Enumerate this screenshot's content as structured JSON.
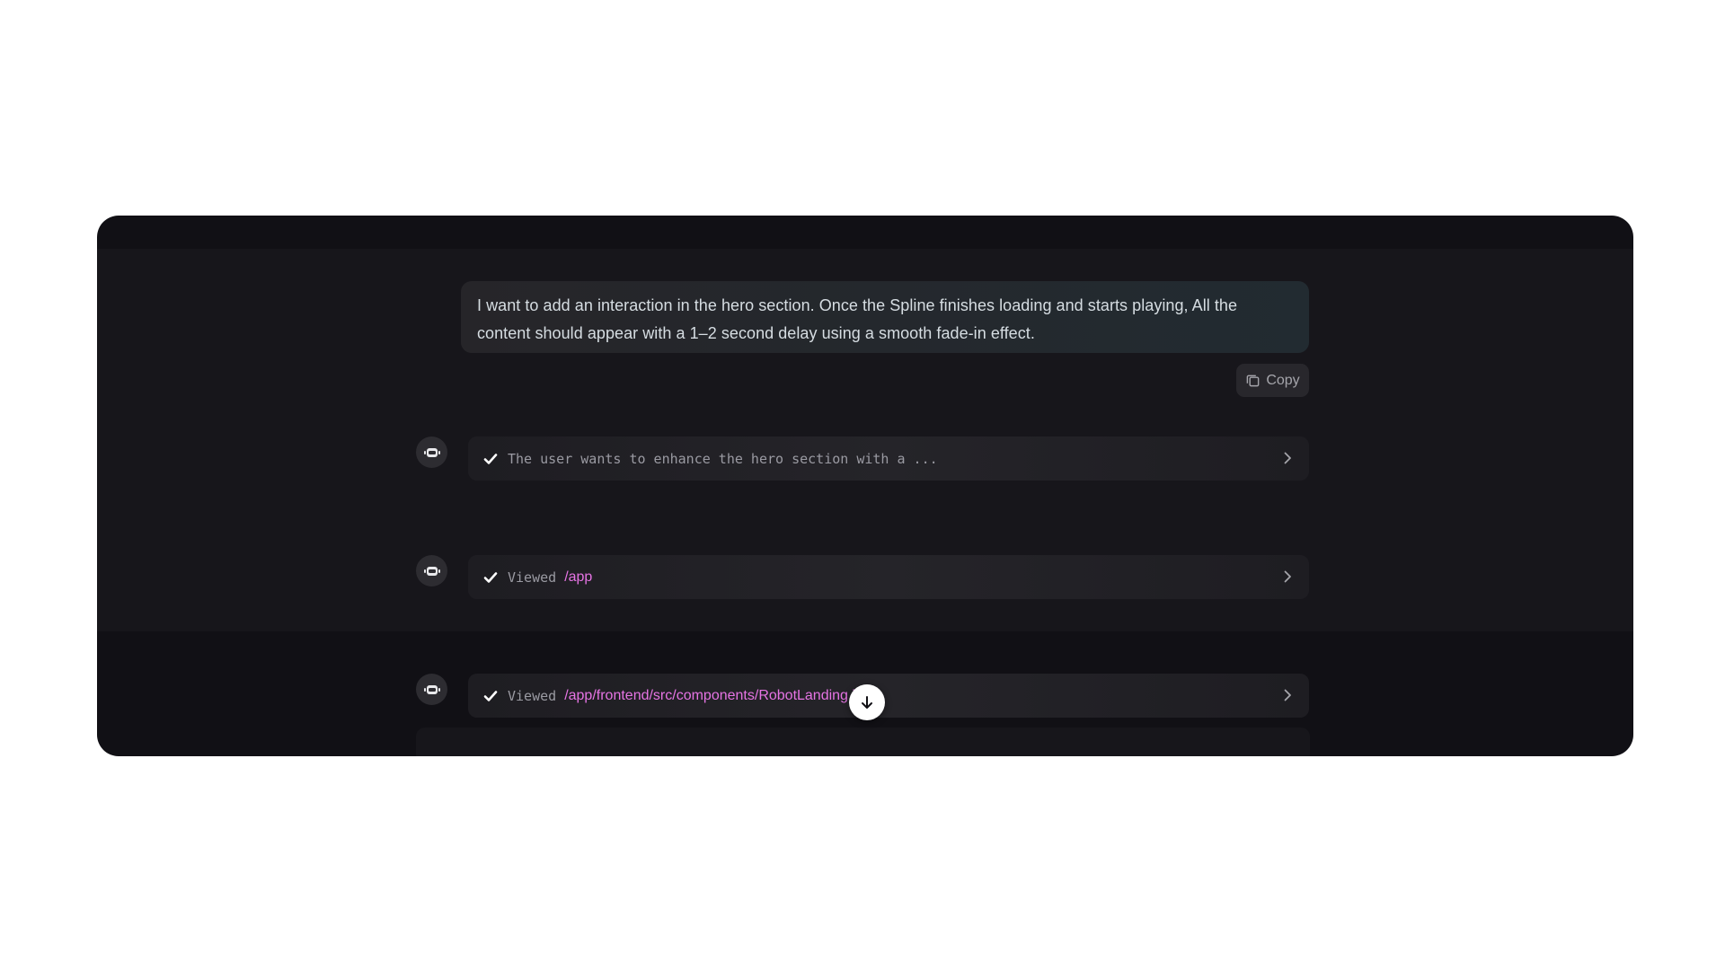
{
  "chat": {
    "user_message": "I want to add an interaction in the hero section. Once the Spline finishes loading and starts playing, All the content should appear with a 1–2 second delay using a smooth fade-in effect.",
    "copy_label": "Copy",
    "steps": [
      {
        "text": "The user wants to enhance the hero section with a ...",
        "path": ""
      },
      {
        "text": "Viewed",
        "path": "/app"
      },
      {
        "text": "Viewed",
        "path": "/app/frontend/src/components/RobotLanding.jsx"
      }
    ]
  },
  "icons": {
    "copy": "copy-icon",
    "avatar": "robot-icon",
    "status": "check-icon",
    "expand": "chevron-right-icon",
    "scroll": "arrow-down-icon"
  },
  "colors": {
    "panel_background": "#111015",
    "path_accent": "#e674e4"
  }
}
